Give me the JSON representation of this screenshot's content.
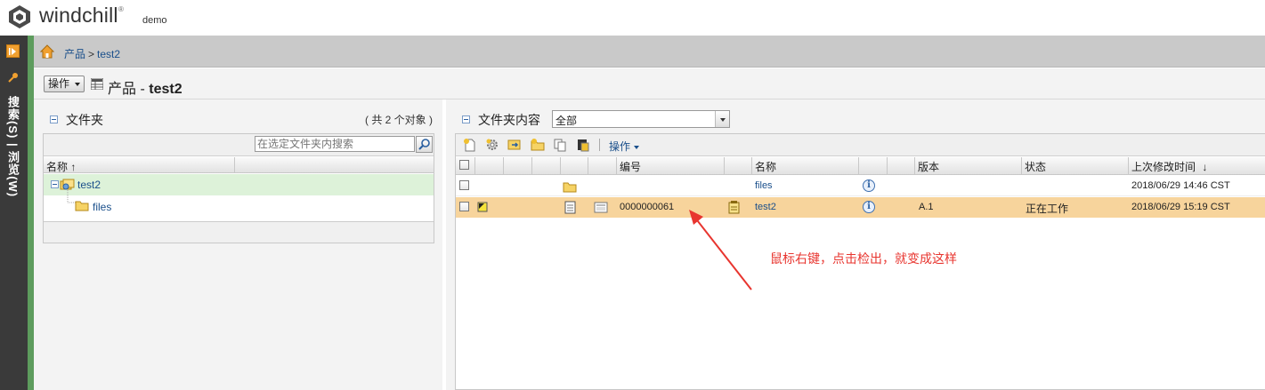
{
  "header": {
    "app_name": "windchill",
    "trademark": "®",
    "site_name": "demo"
  },
  "rail": {
    "label": "搜索(S) | 浏览(W)"
  },
  "breadcrumb": {
    "items": [
      "产品",
      "test2"
    ],
    "separator": ">"
  },
  "title_bar": {
    "actions_label": "操作",
    "title_prefix": "产品 - ",
    "title_name": "test2"
  },
  "folder_panel": {
    "title": "文件夹",
    "object_count": "( 共 2 个对象 )",
    "search_placeholder": "在选定文件夹内搜索",
    "column_name": "名称",
    "sort_indicator": "↑",
    "tree": [
      {
        "label": "test2",
        "level": 0,
        "selected": true
      },
      {
        "label": "files",
        "level": 1,
        "selected": false
      }
    ]
  },
  "contents_panel": {
    "title": "文件夹内容",
    "scope_value": "全部",
    "actions_label": "操作",
    "toolbar_icons": [
      "new-document-icon",
      "settings-gear-icon",
      "import-icon",
      "new-folder-icon",
      "copy-icon",
      "paste-icon"
    ],
    "columns": {
      "number": "编号",
      "name": "名称",
      "version": "版本",
      "state": "状态",
      "modified": "上次修改时间",
      "modified_sort": "↓"
    },
    "rows": [
      {
        "type": "folder",
        "number": "",
        "name": "files",
        "version": "",
        "state": "",
        "modified": "2018/06/29 14:46 CST",
        "highlighted": false
      },
      {
        "type": "document",
        "number": "0000000061",
        "name": "test2",
        "version": "A.1",
        "state": "正在工作",
        "modified": "2018/06/29 15:19 CST",
        "highlighted": true
      }
    ]
  },
  "annotation": {
    "text": "鼠标右键，点击检出，就变成这样",
    "color": "#e8352f"
  },
  "colors": {
    "rail_bg": "#3a3a3a",
    "rail_accent": "#5d9c5d",
    "selected_tree_row": "#ddf2d9",
    "highlighted_row": "#f7d49c",
    "link": "#1a4f8b"
  }
}
